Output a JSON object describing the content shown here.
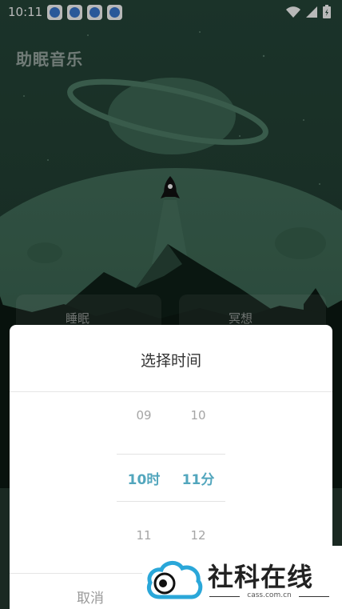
{
  "status_bar": {
    "time": "10:11"
  },
  "app": {
    "title": "助眠音乐"
  },
  "behind_cards": {
    "sleep_label": "睡眠",
    "meditate_label": "冥想"
  },
  "dialog": {
    "title": "选择时间",
    "hour_column": [
      "09",
      "10时",
      "11"
    ],
    "minute_column": [
      "10",
      "11分",
      "12"
    ],
    "cancel_label": "取消"
  },
  "watermark": {
    "name": "社科在线",
    "domain": "cass.com.cn"
  },
  "colors": {
    "accent": "#52a6bd",
    "scene_top": "#2a4a3a",
    "scene_bottom": "#1a3226"
  }
}
